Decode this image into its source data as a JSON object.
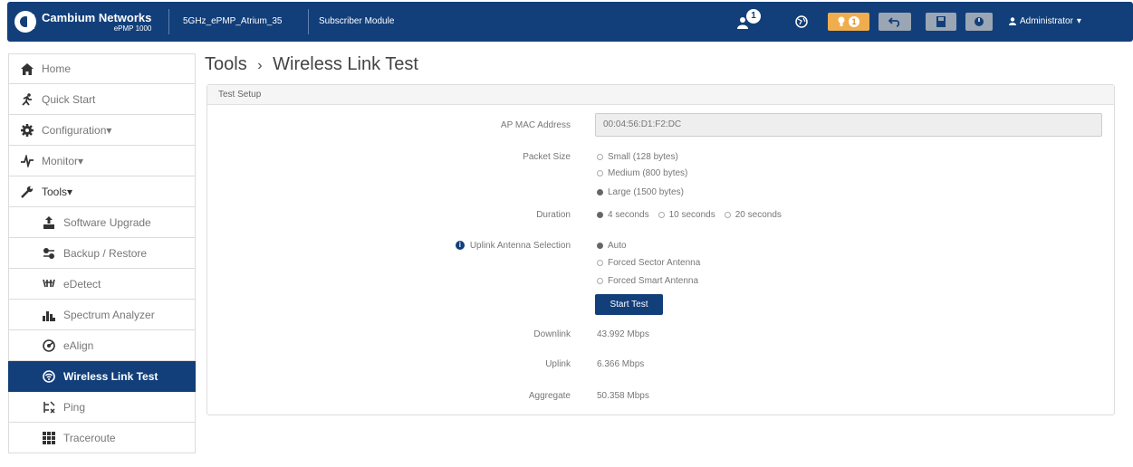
{
  "header": {
    "brand_name": "Cambium Networks",
    "brand_model": "ePMP 1000",
    "device_name": "5GHz_ePMP_Atrium_35",
    "device_role": "Subscriber Module",
    "alerts_count": "1",
    "warnings_count": "1",
    "user_label": "Administrator"
  },
  "sidebar": {
    "items": [
      {
        "label": "Home",
        "icon": "home-icon"
      },
      {
        "label": "Quick Start",
        "icon": "run-icon"
      },
      {
        "label": "Configuration",
        "icon": "gear-icon"
      },
      {
        "label": "Monitor",
        "icon": "pulse-icon"
      },
      {
        "label": "Tools",
        "icon": "wrench-icon"
      },
      {
        "label": "Software Upgrade",
        "icon": "upgrade-icon"
      },
      {
        "label": "Backup / Restore",
        "icon": "backup-icon"
      },
      {
        "label": "eDetect",
        "icon": "edetect-icon"
      },
      {
        "label": "Spectrum Analyzer",
        "icon": "spectrum-icon"
      },
      {
        "label": "eAlign",
        "icon": "ealign-icon"
      },
      {
        "label": "Wireless Link Test",
        "icon": "wireless-icon"
      },
      {
        "label": "Ping",
        "icon": "ping-icon"
      },
      {
        "label": "Traceroute",
        "icon": "traceroute-icon"
      }
    ]
  },
  "main": {
    "title_section": "Tools",
    "title_separator": "›",
    "title_page": "Wireless Link Test",
    "panel_title": "Test Setup",
    "fields": {
      "ap_mac_label": "AP MAC Address",
      "ap_mac_value": "00:04:56:D1:F2:DC",
      "packet_size_label": "Packet Size",
      "packet_size_options": [
        "Small (128 bytes)",
        "Medium (800 bytes)",
        "Large (1500 bytes)"
      ],
      "packet_size_selected": "Large (1500 bytes)",
      "duration_label": "Duration",
      "duration_options": [
        "4 seconds",
        "10 seconds",
        "20 seconds"
      ],
      "duration_selected": "4 seconds",
      "antenna_label": "Uplink Antenna Selection",
      "antenna_options": [
        "Auto",
        "Forced Sector Antenna",
        "Forced Smart Antenna"
      ],
      "antenna_selected": "Auto",
      "start_button": "Start Test",
      "downlink_label": "Downlink",
      "downlink_value": "43.992 Mbps",
      "uplink_label": "Uplink",
      "uplink_value": "6.366 Mbps",
      "aggregate_label": "Aggregate",
      "aggregate_value": "50.358 Mbps"
    }
  },
  "colors": {
    "brand": "#123f7a",
    "warning": "#f0ad4e"
  }
}
